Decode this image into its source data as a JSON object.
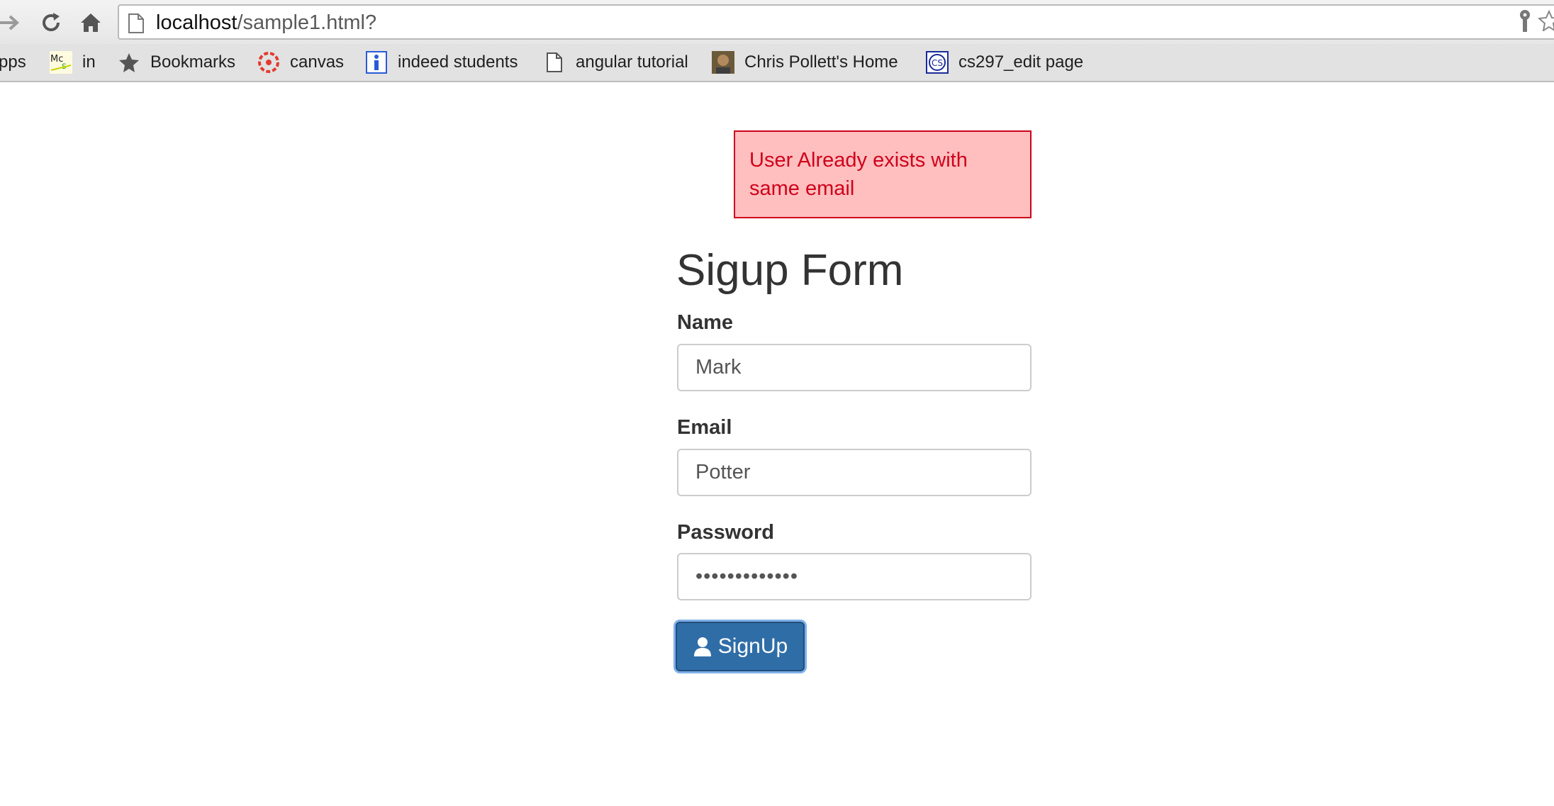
{
  "browser": {
    "url_host": "localhost",
    "url_path": "/sample1.html?",
    "bookmarks": [
      {
        "label": "pps",
        "icon": "apps-icon"
      },
      {
        "label": "in",
        "icon": "mcs-logo-icon"
      },
      {
        "label": "Bookmarks",
        "icon": "star-icon"
      },
      {
        "label": "canvas",
        "icon": "canvas-icon"
      },
      {
        "label": "indeed students",
        "icon": "info-icon"
      },
      {
        "label": "angular tutorial",
        "icon": "page-icon"
      },
      {
        "label": "Chris Pollett's Home",
        "icon": "avatar-icon"
      },
      {
        "label": "cs297_edit page",
        "icon": "cs-logo-icon"
      }
    ]
  },
  "alert": {
    "message": "User Already exists with same email",
    "bg_color": "#ffbfbf",
    "border_color": "#d0021b"
  },
  "form": {
    "title": "Sigup Form",
    "name_label": "Name",
    "name_value": "Mark",
    "email_label": "Email",
    "email_value": "Potter",
    "password_label": "Password",
    "password_value": "•••••••••••••",
    "submit_label": "SignUp",
    "submit_icon": "user-icon",
    "button_color": "#2f6da7"
  }
}
